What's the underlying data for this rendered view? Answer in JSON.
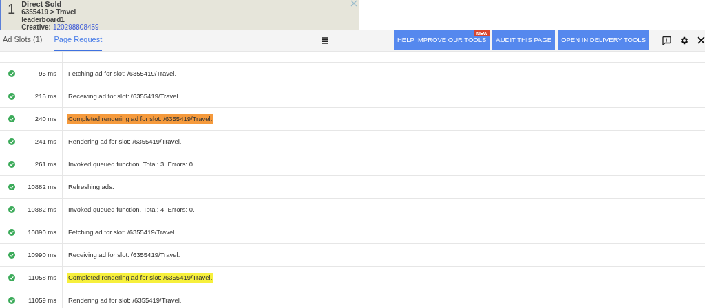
{
  "ad_preview": {
    "slot_number": "1",
    "lines": [
      "Direct Sold",
      "6355419 > Travel",
      "leaderboard1"
    ],
    "creative_label": "Creative:",
    "creative_link": "120298808459"
  },
  "tabs": [
    {
      "label": "Ad Slots (1)",
      "selected": false
    },
    {
      "label": "Page Request",
      "selected": true
    }
  ],
  "buttons": [
    {
      "label": "HELP IMPROVE OUR TOOLS",
      "badge": "NEW"
    },
    {
      "label": "AUDIT THIS PAGE"
    },
    {
      "label": "OPEN IN DELIVERY TOOLS"
    }
  ],
  "rows": [
    {
      "success": true,
      "time": "95 ms",
      "message": "Fetching ad for slot: /6355419/Travel."
    },
    {
      "success": true,
      "time": "215 ms",
      "message": "Receiving ad for slot: /6355419/Travel."
    },
    {
      "success": true,
      "time": "240 ms",
      "message": "Completed rendering ad for slot: /6355419/Travel.",
      "color": "#f59a3c"
    },
    {
      "success": true,
      "time": "241 ms",
      "message": "Rendering ad for slot: /6355419/Travel."
    },
    {
      "success": true,
      "time": "261 ms",
      "message": "Invoked queued function. Total: 3. Errors: 0."
    },
    {
      "success": true,
      "time": "10882 ms",
      "message": "Refreshing ads."
    },
    {
      "success": true,
      "time": "10882 ms",
      "message": "Invoked queued function. Total: 4. Errors: 0."
    },
    {
      "success": true,
      "time": "10890 ms",
      "message": "Fetching ad for slot: /6355419/Travel."
    },
    {
      "success": true,
      "time": "10990 ms",
      "message": "Receiving ad for slot: /6355419/Travel."
    },
    {
      "success": true,
      "time": "11058 ms",
      "message": "Completed rendering ad for slot: /6355419/Travel.",
      "color": "#f7f03c"
    },
    {
      "success": true,
      "time": "11059 ms",
      "message": "Rendering ad for slot: /6355419/Travel."
    }
  ]
}
